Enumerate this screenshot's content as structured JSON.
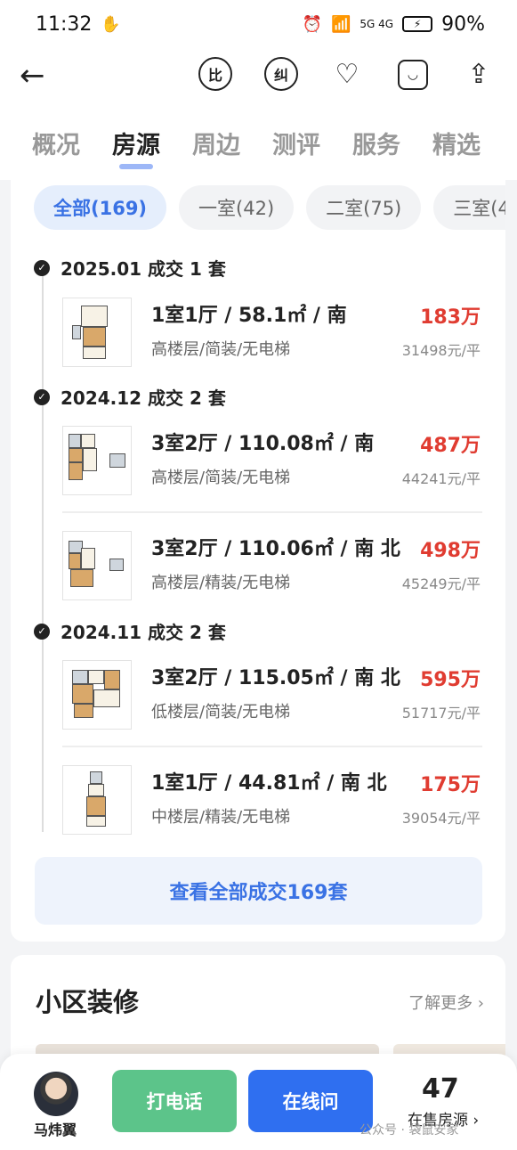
{
  "status_bar": {
    "time": "11:32",
    "network": "5G 4G",
    "battery": "90%"
  },
  "toolbar": {
    "compare_icon_label": "比",
    "correction_icon_label": "纠"
  },
  "tabs": [
    {
      "label": "概况"
    },
    {
      "label": "房源"
    },
    {
      "label": "周边"
    },
    {
      "label": "测评"
    },
    {
      "label": "服务"
    },
    {
      "label": "精选"
    }
  ],
  "filters": [
    {
      "label": "全部(169)"
    },
    {
      "label": "一室(42)"
    },
    {
      "label": "二室(75)"
    },
    {
      "label": "三室(4"
    }
  ],
  "groups": [
    {
      "title": "2025.01 成交 1 套",
      "deals": [
        {
          "title": "1室1厅 / 58.1㎡ / 南",
          "sub": "高楼层/简装/无电梯",
          "price": "183万",
          "unit": "31498元/平"
        }
      ]
    },
    {
      "title": "2024.12 成交 2 套",
      "deals": [
        {
          "title": "3室2厅 / 110.08㎡ / 南",
          "sub": "高楼层/简装/无电梯",
          "price": "487万",
          "unit": "44241元/平"
        },
        {
          "title": "3室2厅 / 110.06㎡ / 南 北",
          "sub": "高楼层/精装/无电梯",
          "price": "498万",
          "unit": "45249元/平"
        }
      ]
    },
    {
      "title": "2024.11 成交 2 套",
      "deals": [
        {
          "title": "3室2厅 / 115.05㎡ / 南 北",
          "sub": "低楼层/简装/无电梯",
          "price": "595万",
          "unit": "51717元/平"
        },
        {
          "title": "1室1厅 / 44.81㎡ / 南 北",
          "sub": "中楼层/精装/无电梯",
          "price": "175万",
          "unit": "39054元/平"
        }
      ]
    }
  ],
  "view_all_label": "查看全部成交169套",
  "renovation": {
    "title": "小区装修",
    "more_label": "了解更多 ›"
  },
  "bottom": {
    "agent_name": "马炜翼",
    "call_label": "打电话",
    "ask_label": "在线问",
    "for_sale_count": "47",
    "for_sale_label": "在售房源 ›",
    "watermark": "公众号 · 袋鼠安家"
  }
}
